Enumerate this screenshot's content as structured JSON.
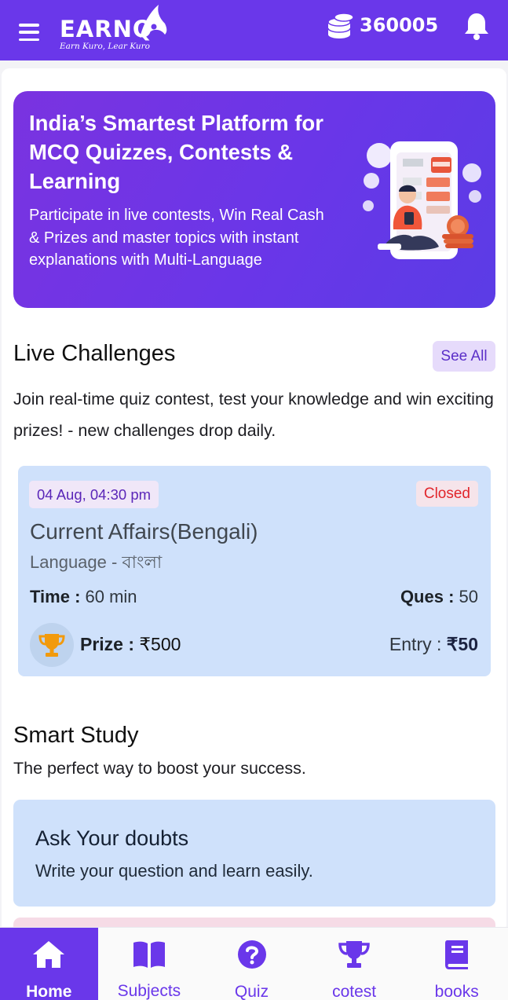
{
  "header": {
    "logo_text": "EARNQ",
    "logo_tagline": "Earn Kuro, Lear Kuro",
    "coin_balance": "360005",
    "icons": [
      "menu-icon",
      "coins-icon",
      "bell-icon"
    ],
    "brand_color": "#6a37ea"
  },
  "hero": {
    "title": "India’s Smartest Platform for MCQ Quizzes, Contests & Learning",
    "description": "Participate in live contests, Win Real Cash & Prizes and master topics with instant explanations with Multi-Language"
  },
  "live_challenges": {
    "title": "Live Challenges",
    "see_all_label": "See All",
    "description": "Join real-time quiz contest, test your knowledge and win exciting prizes! - new challenges drop daily.",
    "card": {
      "date": "04 Aug, 04:30 pm",
      "status": "Closed",
      "title": "Current Affairs(Bengali)",
      "language": "Language - বাংলা",
      "time_label": "Time :",
      "time_value": " 60 min",
      "ques_label": "Ques :",
      "ques_value": " 50",
      "prize_label": "Prize :",
      "prize_value": " ₹500",
      "entry_label": "Entry : ",
      "entry_value": "₹50"
    }
  },
  "smart_study": {
    "title": "Smart Study",
    "description": "The perfect way to boost your success.",
    "doubt_card": {
      "title": "Ask Your doubts",
      "description": "Write your question and learn easily."
    }
  },
  "bottom_nav": {
    "items": [
      {
        "label": "Home",
        "icon": "home-icon",
        "active": true
      },
      {
        "label": "Subjects",
        "icon": "book-open-icon",
        "active": false
      },
      {
        "label": "Quiz",
        "icon": "question-circle-icon",
        "active": false
      },
      {
        "label": "cotest",
        "icon": "trophy-icon",
        "active": false
      },
      {
        "label": "books",
        "icon": "book-icon",
        "active": false
      }
    ]
  }
}
